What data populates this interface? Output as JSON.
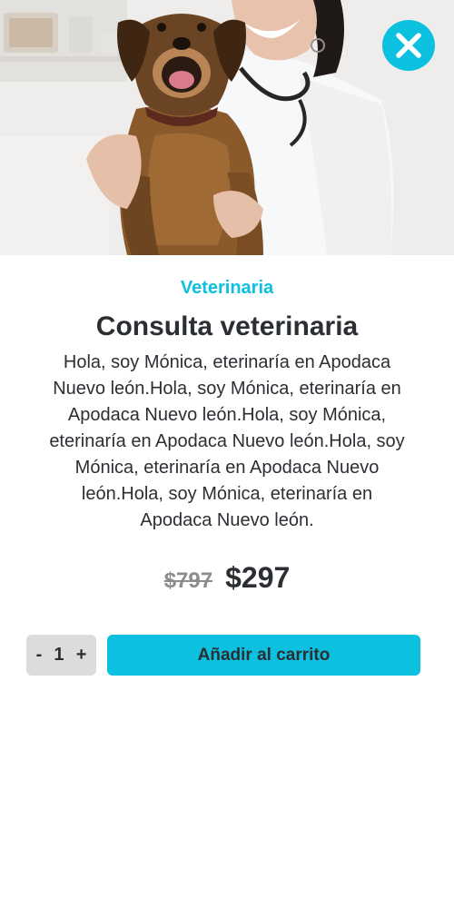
{
  "hero": {
    "image_icon": "veterinarian-holding-dog-photo",
    "close_icon": "close-icon"
  },
  "product": {
    "category": "Veterinaria",
    "title": "Consulta veterinaria",
    "description": "Hola, soy Mónica, eterinaría en Apodaca Nuevo león.Hola, soy Mónica, eterinaría en Apodaca Nuevo león.Hola, soy Mónica, eterinaría en Apodaca Nuevo león.Hola, soy Mónica, eterinaría en Apodaca Nuevo león.Hola, soy Mónica, eterinaría en Apodaca Nuevo león.",
    "old_price": "$797",
    "price": "$297"
  },
  "cart": {
    "decrement_label": "-",
    "quantity": "1",
    "increment_label": "+",
    "add_button_label": "Añadir al carrito"
  },
  "colors": {
    "accent": "#0cc0df",
    "text": "#2b2f33",
    "muted": "#8a8c8e",
    "stepper_bg": "#dcdcdc"
  }
}
